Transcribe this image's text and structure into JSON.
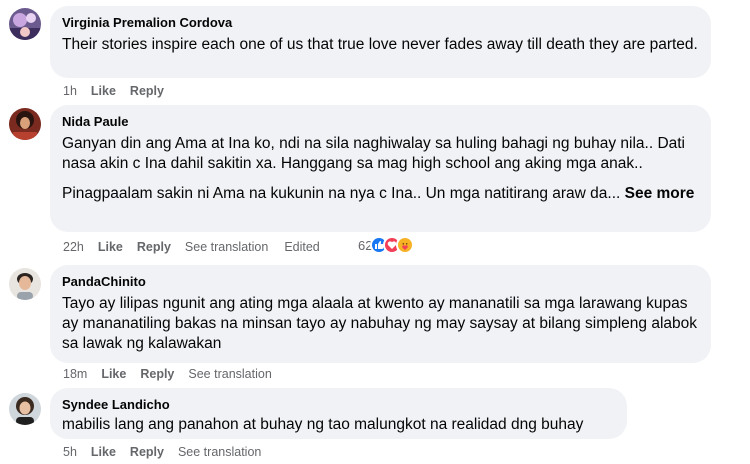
{
  "colors": {
    "bubble": "#f0f2f5",
    "meta_text": "#65676b",
    "like_blue": "#1877f2",
    "heart_red": "#f33e58",
    "care_yellow": "#f7b125"
  },
  "comments": [
    {
      "author": "Virginia Premalion Cordova",
      "paragraphs": [
        "Their stories inspire each one of us that true love never fades away till death they are parted."
      ],
      "time": "1h",
      "like": "Like",
      "reply": "Reply"
    },
    {
      "author": "Nida Paule",
      "paragraphs": [
        "Ganyan din ang Ama at Ina ko, ndi na sila naghiwalay sa huling bahagi ng buhay nila.. Dati nasa akin c Ina dahil sakitin xa. Hanggang sa mag high school ang aking mga anak..",
        "Pinagpaalam sakin ni Ama na kukunin na nya c Ina.. Un mga natitirang araw da..."
      ],
      "see_more": "See more",
      "time": "22h",
      "like": "Like",
      "reply": "Reply",
      "see_translation": "See translation",
      "edited": "Edited",
      "reaction_count": "62",
      "reaction_icons": [
        "like-icon",
        "heart-icon",
        "care-icon"
      ]
    },
    {
      "author": "PandaChinito",
      "paragraphs": [
        "Tayo ay lilipas ngunit ang ating mga alaala at kwento ay mananatili sa mga larawang kupas ay mananatiling bakas na minsan tayo ay nabuhay ng may saysay at bilang simpleng alabok sa lawak ng kalawakan"
      ],
      "time": "18m",
      "like": "Like",
      "reply": "Reply",
      "see_translation": "See translation"
    },
    {
      "author": "Syndee Landicho",
      "paragraphs": [
        "mabilis lang ang panahon at buhay ng tao malungkot na realidad dng buhay"
      ],
      "time": "5h",
      "like": "Like",
      "reply": "Reply",
      "see_translation": "See translation"
    }
  ]
}
